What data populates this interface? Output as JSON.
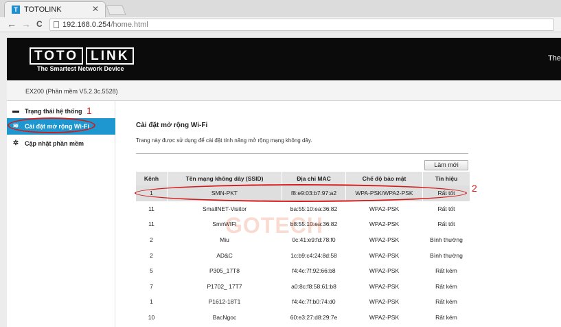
{
  "browser": {
    "tab_title": "TOTOLINK",
    "favicon_letter": "T",
    "close_glyph": "✕",
    "back_glyph": "←",
    "forward_glyph": "→",
    "reload_glyph": "C",
    "url_host": "192.168.0.254",
    "url_path": "/home.html"
  },
  "header": {
    "logo_left": "TOTO",
    "logo_right": "LINK",
    "tagline": "The Smartest Network Device",
    "right_text": "The"
  },
  "infobar": {
    "model": "EX200 (Phần mềm V5.2.3c.5528)"
  },
  "sidebar": {
    "items": [
      {
        "label": "Trạng thái hệ thống",
        "icon": "chat-icon",
        "glyph": "▬"
      },
      {
        "label": "Cài đặt mở rộng Wi-Fi",
        "icon": "wifi-icon",
        "glyph": "≋"
      },
      {
        "label": "Cập nhật phần mềm",
        "icon": "gear-icon",
        "glyph": "✲"
      }
    ]
  },
  "content": {
    "title": "Cài đặt mở rộng Wi-Fi",
    "description": "Trang này được sử dụng để cài đặt tính năng mở rộng mạng không dây.",
    "refresh_label": "Làm mới"
  },
  "table": {
    "headers": [
      "Kênh",
      "Tên mạng không dây (SSID)",
      "Địa chỉ MAC",
      "Chế độ bảo mật",
      "Tín hiệu"
    ],
    "rows": [
      [
        "1",
        "SMN-PKT",
        "f8:e9:03:b7:97:a2",
        "WPA-PSK/WPA2-PSK",
        "Rất tốt"
      ],
      [
        "11",
        "SmallNET-Visitor",
        "ba:55:10:ea:36:82",
        "WPA2-PSK",
        "Rất tốt"
      ],
      [
        "11",
        "SmnWIFI",
        "b8:55:10:ea:36:82",
        "WPA2-PSK",
        "Rất tốt"
      ],
      [
        "2",
        "Miu",
        "0c:41:e9:fd:78:f0",
        "WPA2-PSK",
        "Bình thường"
      ],
      [
        "2",
        "AD&C",
        "1c:b9:c4:24:8d:58",
        "WPA2-PSK",
        "Bình thường"
      ],
      [
        "5",
        "P305_17T8",
        "f4:4c:7f:92:66:b8",
        "WPA2-PSK",
        "Rất kém"
      ],
      [
        "7",
        "P1702_ 17T7",
        "a0:8c:f8:58:61:b8",
        "WPA2-PSK",
        "Rất kém"
      ],
      [
        "1",
        "P1612-18T1",
        "f4:4c:7f:b0:74:d0",
        "WPA2-PSK",
        "Rất kém"
      ],
      [
        "10",
        "BacNgoc",
        "60:e3:27:d8:29:7e",
        "WPA2-PSK",
        "Rất kém"
      ]
    ]
  },
  "annotations": {
    "step1": "1",
    "step2": "2"
  },
  "watermark": "GOTECH",
  "colors": {
    "accent": "#1e96cf",
    "annotation": "#d21c1c",
    "header_bg": "#0b0b0b"
  }
}
